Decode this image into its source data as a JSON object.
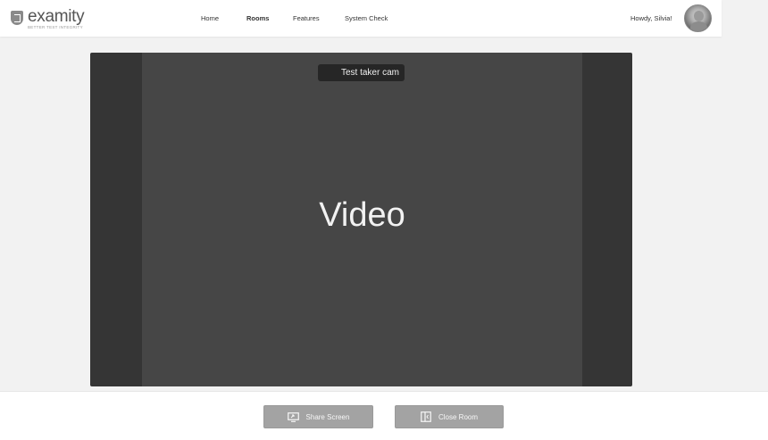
{
  "header": {
    "logo": {
      "wordmark": "examity",
      "tagline": "BETTER TEST INTEGRITY"
    },
    "nav": [
      {
        "label": "Home",
        "active": false
      },
      {
        "label": "Rooms",
        "active": true
      },
      {
        "label": "Features",
        "active": false
      },
      {
        "label": "System Check",
        "active": false
      }
    ],
    "greeting": "Howdy, Silvia!"
  },
  "video": {
    "cam_label": "Test taker cam",
    "placeholder": "Video"
  },
  "actions": {
    "share_screen": {
      "label": "Share Screen",
      "icon": "share-screen-icon"
    },
    "close_room": {
      "label": "Close Room",
      "icon": "close-room-icon"
    }
  },
  "colors": {
    "page_bg": "#f2f2f2",
    "video_outer": "#353535",
    "video_inner": "#464646",
    "button_bg": "#a3a3a3"
  }
}
